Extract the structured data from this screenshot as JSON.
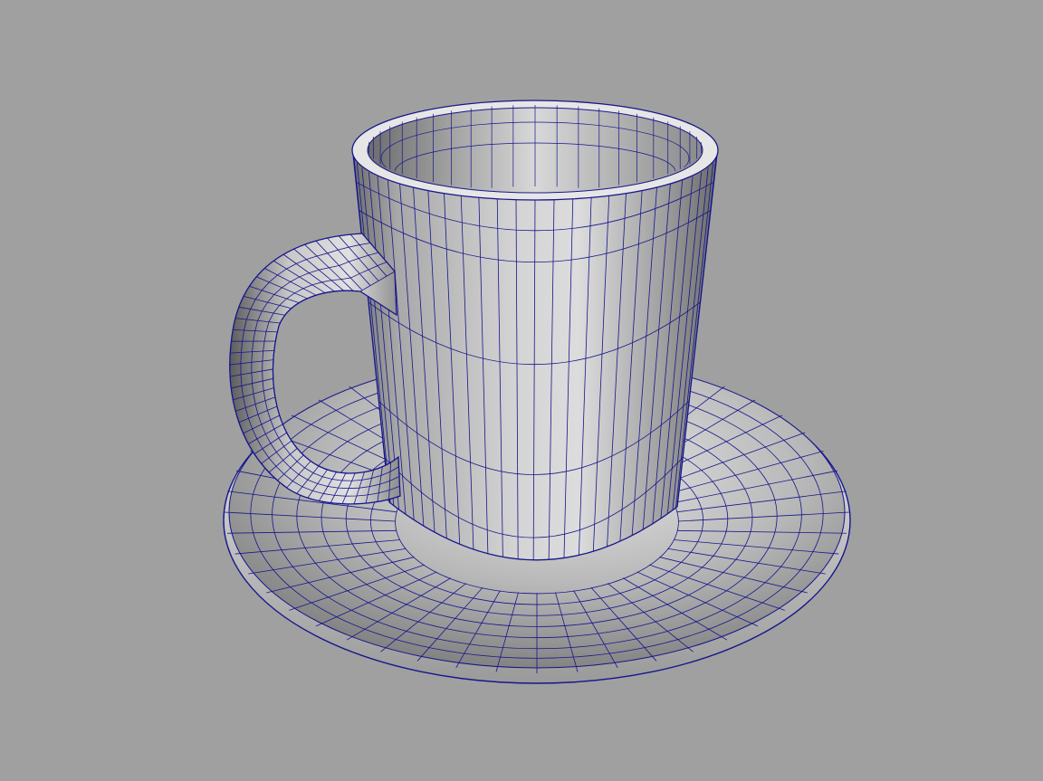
{
  "viewport": {
    "background_color": "#a0a0a0"
  },
  "scene": {
    "objects": [
      "saucer",
      "mug",
      "mug-handle"
    ],
    "display_mode": "smooth-shaded-with-wireframe",
    "wireframe_color": "#16168c",
    "shade_light_color": "#ebebeb",
    "shade_dark_color": "#4a4a4a"
  }
}
